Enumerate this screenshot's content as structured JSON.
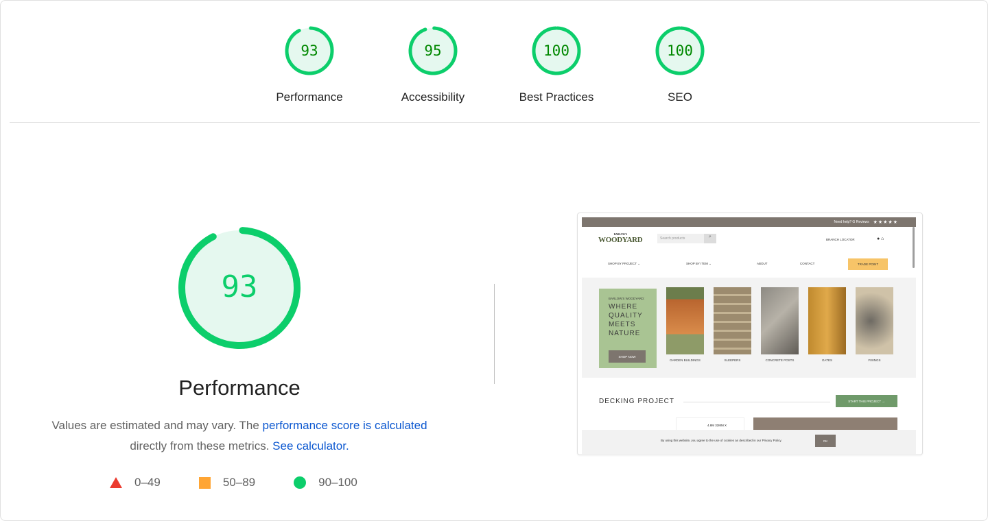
{
  "top_gauges": [
    {
      "label": "Performance",
      "score": 93
    },
    {
      "label": "Accessibility",
      "score": 95
    },
    {
      "label": "Best Practices",
      "score": 100
    },
    {
      "label": "SEO",
      "score": 100
    }
  ],
  "colors": {
    "pass": "#0cce6b",
    "pass_fill": "#e5f8ef",
    "pass_text": "#008800",
    "average": "#ffa534",
    "fail": "#eb3b2f",
    "link": "#0b57d0"
  },
  "performance": {
    "score": 93,
    "title": "Performance",
    "desc_part1": "Values are estimated and may vary. The",
    "desc_link1": "performance score is calculated",
    "desc_part2": "directly from these metrics.",
    "desc_link2": "See calculator."
  },
  "legend": [
    {
      "shape": "triangle",
      "range": "0–49"
    },
    {
      "shape": "square",
      "range": "50–89"
    },
    {
      "shape": "circle",
      "range": "90–100"
    }
  ],
  "site": {
    "topbar": "Need help?  G Reviews",
    "stars": "★★★★★",
    "logo_top": "BARLOW'S",
    "logo": "WOODYARD",
    "search_placeholder": "Search products",
    "branch_locator": "BRANCH LOCATOR",
    "nav": [
      "SHOP BY PROJECT ⌄",
      "SHOP BY ITEM ⌄",
      "ABOUT",
      "CONTACT"
    ],
    "trade_point": "TRADE POINT",
    "hero_small": "BARLOW'S WOODYARD:",
    "hero_big": "WHERE QUALITY MEETS NATURE",
    "shop_now": "SHOP NOW",
    "categories": [
      "GARDEN BUILDINGS",
      "SLEEPERS",
      "CONCRETE POSTS",
      "GATES",
      "FIXINGS"
    ],
    "decking": "DECKING PROJECT",
    "start_project": "START THIS PROJECT →",
    "product_snippet": "4.8M 32MM X",
    "cookie_text": "By using this website, you agree to the use of cookies as described in our Privacy Policy.",
    "cookie_ok": "OK"
  }
}
